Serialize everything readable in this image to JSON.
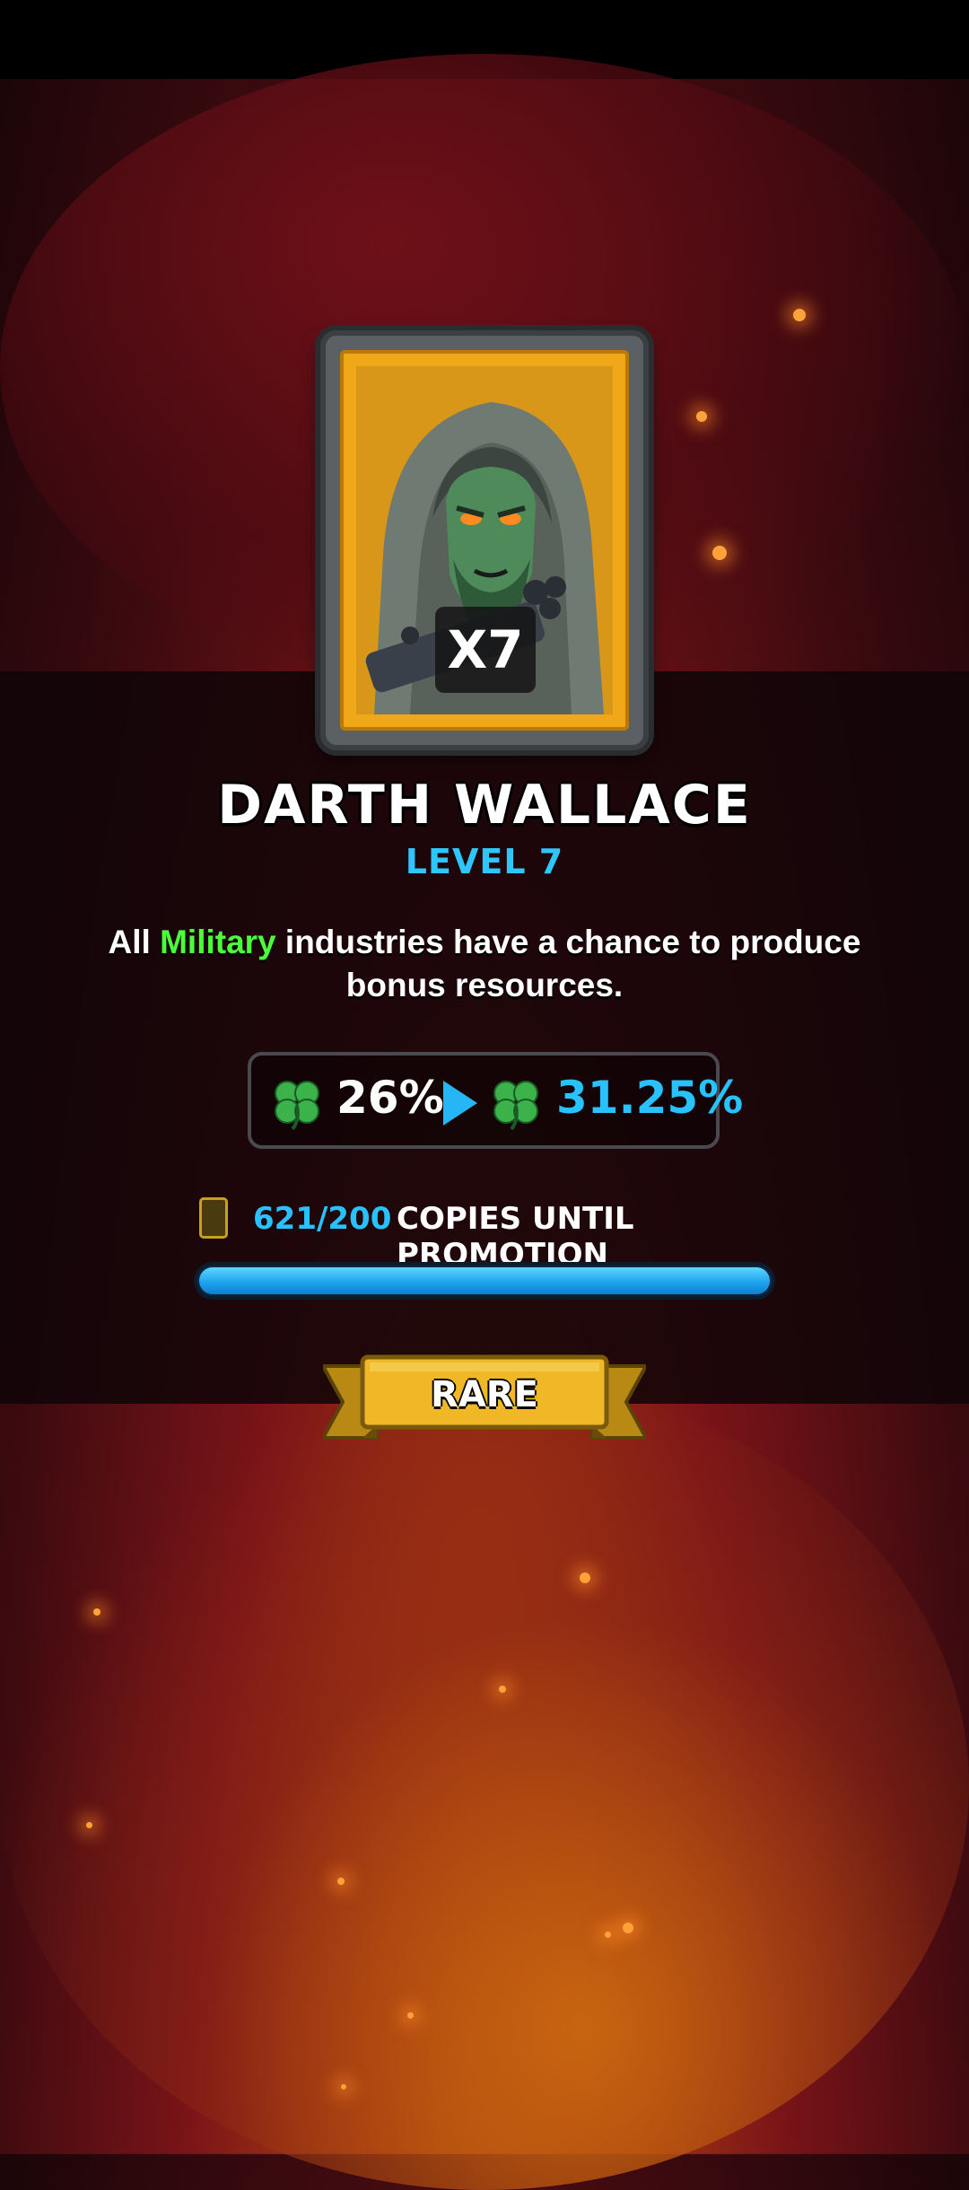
{
  "card": {
    "multiplier": "X7",
    "name": "DARTH WALLACE",
    "level": "LEVEL 7",
    "description_before": "All ",
    "description_highlight": "Military",
    "description_after": " industries have a chance to produce bonus resources.",
    "stat_current": "26%",
    "stat_next": "31.25%",
    "copies_count": "621/200",
    "copies_label": "COPIES UNTIL PROMOTION",
    "progress_fraction": 1.0,
    "rarity": "RARE"
  },
  "colors": {
    "highlight": "#4cff3a",
    "accent_blue": "#27c2ff",
    "card_gold": "#f0a818",
    "ribbon_gold": "#f0b826"
  },
  "icons": {
    "stat": "four-leaf-clover-icon",
    "arrow": "play-arrow-icon",
    "copies": "card-icon"
  }
}
